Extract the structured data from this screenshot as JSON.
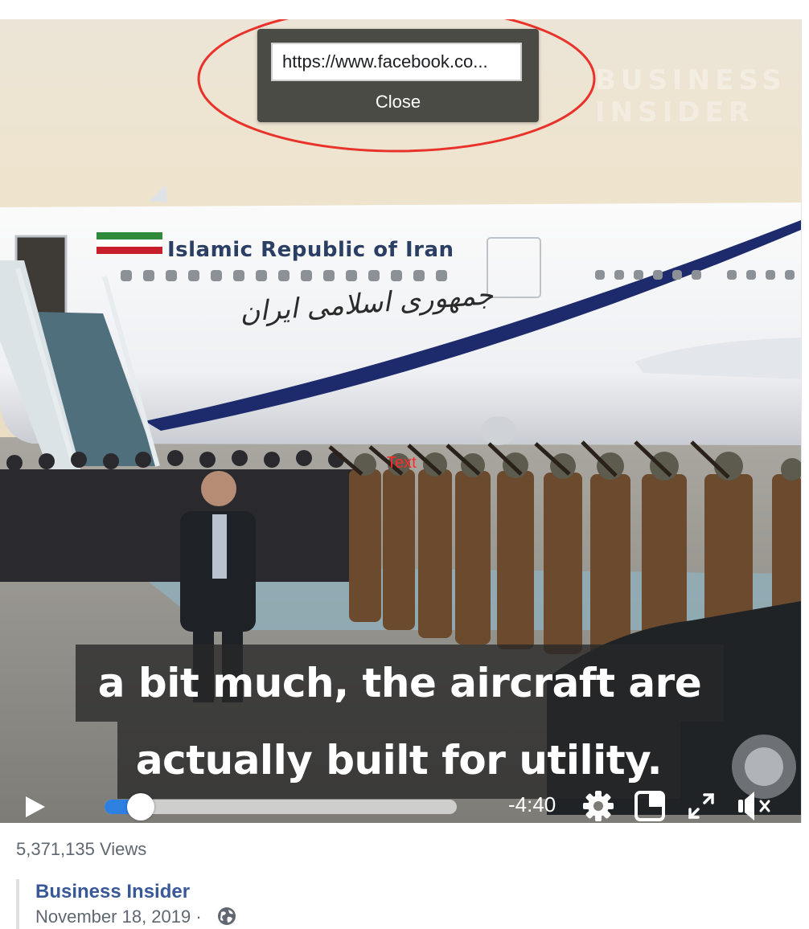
{
  "share_popup": {
    "url_value": "https://www.facebook.com/businessinsider/videos/",
    "url_display": "https://www.facebook.co...",
    "close_label": "Close"
  },
  "video": {
    "watermark_line1": "BUSINESS",
    "watermark_line2": "INSIDER",
    "aircraft_livery_text": "Islamic Republic of Iran",
    "aircraft_livery_arabic": "جمهوری اسلامی ایران",
    "overlay_label": "Text",
    "caption_line1": "a bit much, the aircraft are",
    "caption_line2": "actually built for utility.",
    "time_remaining": "-4:40",
    "progress": 0.05,
    "colors": {
      "annotation_circle": "#e8322a",
      "progress_accent": "#2d7fe0",
      "caption_bg": "#282828"
    },
    "icons": {
      "play": "play-icon",
      "settings": "gear-icon",
      "pip": "picture-in-picture-icon",
      "fullscreen": "fullscreen-icon",
      "mute": "muted-speaker-icon"
    }
  },
  "post": {
    "views": "5,371,135 Views",
    "page_name": "Business Insider",
    "date": "November 18, 2019 ·",
    "privacy_icon": "globe-icon",
    "link_color": "#385898"
  }
}
